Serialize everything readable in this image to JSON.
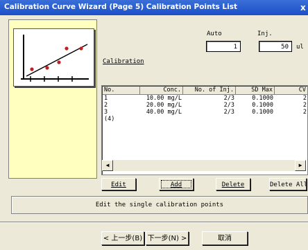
{
  "window": {
    "title": "Calibration Curve Wizard (Page 5) Calibration Points List",
    "close_label": "x"
  },
  "auto": {
    "label": "Auto",
    "value": "1"
  },
  "inj": {
    "label": "Inj.",
    "value": "50",
    "unit": "ul"
  },
  "calibration_label": "Calibration",
  "table": {
    "columns": [
      "No.",
      "Conc.",
      "No. of Inj.",
      "SD Max",
      "CV"
    ],
    "rows": [
      {
        "no": "1",
        "conc": "10.00 mg/L",
        "inj": "2/3",
        "sd": "0.1000",
        "cv": "2"
      },
      {
        "no": "2",
        "conc": "20.00 mg/L",
        "inj": "2/3",
        "sd": "0.1000",
        "cv": "2"
      },
      {
        "no": "3",
        "conc": "40.00 mg/L",
        "inj": "2/3",
        "sd": "0.1000",
        "cv": "2"
      },
      {
        "no": "(4)",
        "conc": "",
        "inj": "",
        "sd": "",
        "cv": ""
      }
    ]
  },
  "buttons": {
    "edit": "Edit",
    "add": "Add",
    "delete": "Delete",
    "delete_all": "Delete All"
  },
  "description": "Edit the single calibration points",
  "nav": {
    "back": "< 上一步(B)",
    "next": "下一步(N) >",
    "cancel": "取消"
  },
  "colors": {
    "title_bar": "#1c4fc8",
    "left_panel": "#ffffc0",
    "point_color": "#c02020"
  },
  "icons": [
    "calibration-chart-icon",
    "scroll-left-icon",
    "scroll-right-icon",
    "close-icon"
  ]
}
